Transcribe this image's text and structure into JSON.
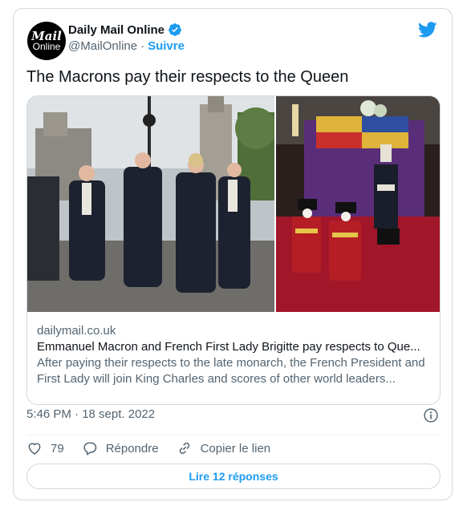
{
  "author": {
    "avatar_line1": "Mail",
    "avatar_line2": "Online",
    "name": "Daily Mail Online",
    "handle": "@MailOnline",
    "separator": "·",
    "follow_label": "Suivre"
  },
  "tweet": {
    "text": "The Macrons pay their respects to the Queen"
  },
  "link_card": {
    "domain": "dailymail.co.uk",
    "title": "Emmanuel Macron and French First Lady Brigitte pay respects to Que...",
    "description": "After paying their respects to the late monarch, the French President and First Lady will join King Charles and scores of other world leaders..."
  },
  "meta": {
    "timestamp": "5:46 PM · 18 sept. 2022"
  },
  "actions": {
    "like_count": "79",
    "reply_label": "Répondre",
    "copy_label": "Copier le lien"
  },
  "replies_button": "Lire 12 réponses",
  "icons": {
    "verified": "verified-badge-icon",
    "twitter": "twitter-bird-icon",
    "info": "info-icon",
    "like": "heart-icon",
    "reply": "comment-icon",
    "copy": "link-icon"
  },
  "colors": {
    "accent": "#1d9bf0",
    "text": "#0f1419",
    "muted": "#536471",
    "border": "#cfd9de"
  }
}
